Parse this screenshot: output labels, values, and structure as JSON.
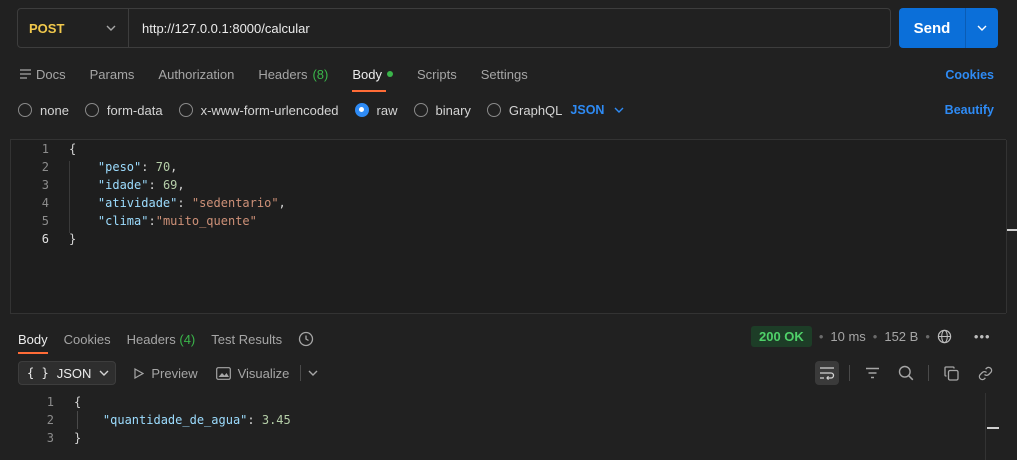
{
  "request": {
    "method": "POST",
    "url": "http://127.0.0.1:8000/calcular",
    "send_label": "Send"
  },
  "tabs": [
    {
      "label": "Docs"
    },
    {
      "label": "Params"
    },
    {
      "label": "Authorization"
    },
    {
      "label": "Headers",
      "count": "(8)"
    },
    {
      "label": "Body"
    },
    {
      "label": "Scripts"
    },
    {
      "label": "Settings"
    }
  ],
  "cookies_label": "Cookies",
  "body_types": [
    "none",
    "form-data",
    "x-www-form-urlencoded",
    "raw",
    "binary",
    "GraphQL"
  ],
  "selected_body_type": "raw",
  "language": "JSON",
  "beautify_label": "Beautify",
  "request_body": {
    "lines": [
      "1",
      "2",
      "3",
      "4",
      "5",
      "6"
    ],
    "open": "{",
    "close": "}",
    "fields": [
      {
        "key": "\"peso\"",
        "sep": ": ",
        "value": "70",
        "trail": ","
      },
      {
        "key": "\"idade\"",
        "sep": ": ",
        "value": "69",
        "trail": ","
      },
      {
        "key": "\"atividade\"",
        "sep": ": ",
        "value": "\"sedentario\"",
        "trail": ","
      },
      {
        "key": "\"clima\"",
        "sep": ":",
        "value": "\"muito_quente\"",
        "trail": ""
      }
    ]
  },
  "response": {
    "tabs": [
      {
        "label": "Body"
      },
      {
        "label": "Cookies"
      },
      {
        "label": "Headers",
        "count": "(4)"
      },
      {
        "label": "Test Results"
      }
    ],
    "status": "200 OK",
    "time": "10 ms",
    "size": "152 B",
    "format": "JSON",
    "preview_label": "Preview",
    "visualize_label": "Visualize",
    "lines": [
      "1",
      "2",
      "3"
    ],
    "open": "{",
    "close": "}",
    "field_key": "\"quantidade_de_agua\"",
    "field_sep": ": ",
    "field_value": "3.45"
  }
}
